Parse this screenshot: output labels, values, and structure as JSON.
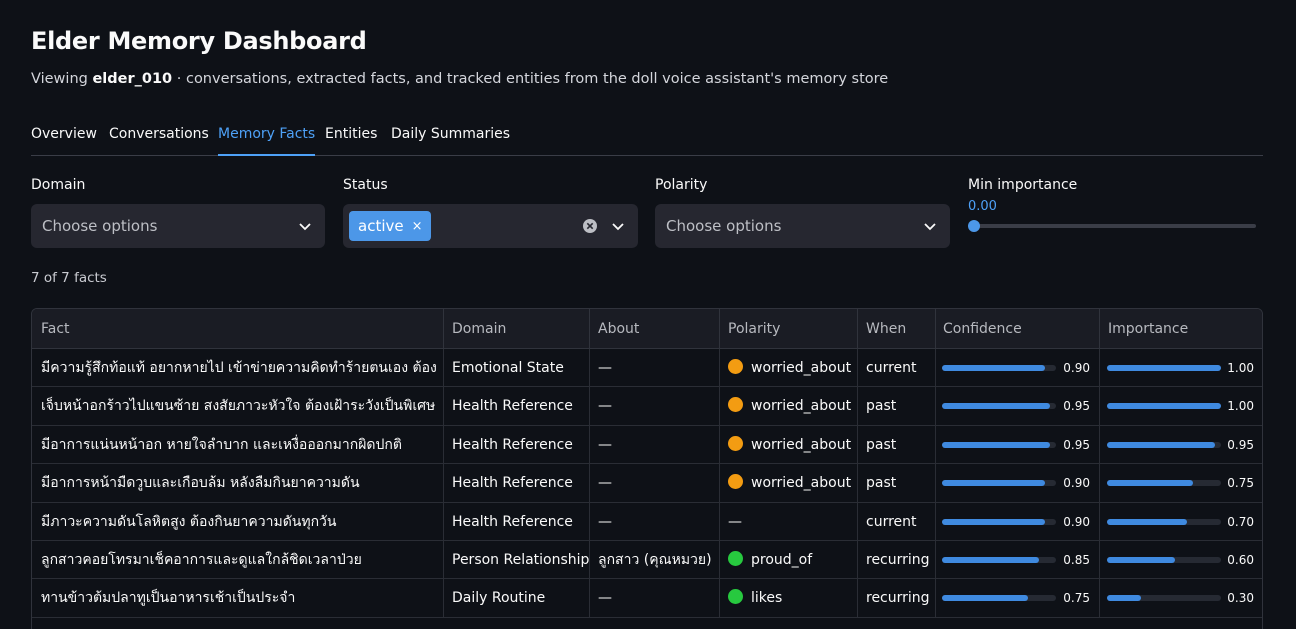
{
  "header": {
    "title": "Elder Memory Dashboard",
    "subtitle_prefix": "Viewing ",
    "subtitle_user": "elder_010",
    "subtitle_suffix": " · conversations, extracted facts, and tracked entities from the doll voice assistant's memory store"
  },
  "tabs": [
    {
      "label": "Overview",
      "active": false
    },
    {
      "label": "Conversations",
      "active": false
    },
    {
      "label": "Memory Facts",
      "active": true
    },
    {
      "label": "Entities",
      "active": false
    },
    {
      "label": "Daily Summaries",
      "active": false
    }
  ],
  "filters": {
    "domain": {
      "label": "Domain",
      "placeholder": "Choose options"
    },
    "status": {
      "label": "Status",
      "selected": "active",
      "remove_glyph": "×"
    },
    "polarity": {
      "label": "Polarity",
      "placeholder": "Choose options"
    },
    "min_importance": {
      "label": "Min importance",
      "value": "0.00",
      "fraction": 0.0
    }
  },
  "count_text": "7 of 7 facts",
  "table": {
    "columns": [
      "Fact",
      "Domain",
      "About",
      "Polarity",
      "When",
      "Confidence",
      "Importance"
    ],
    "rows": [
      {
        "fact": "มีความรู้สึกท้อแท้ อยากหายไป เข้าข่ายความคิดทำร้ายตนเอง ต้อง",
        "domain": "Emotional State",
        "about": "—",
        "polarity": "worried_about",
        "polarity_color": "#f39c12",
        "when": "current",
        "confidence": 0.9,
        "confidence_text": "0.90",
        "importance": 1.0,
        "importance_text": "1.00"
      },
      {
        "fact": "เจ็บหน้าอกร้าวไปแขนซ้าย สงสัยภาวะหัวใจ ต้องเฝ้าระวังเป็นพิเศษ",
        "domain": "Health Reference",
        "about": "—",
        "polarity": "worried_about",
        "polarity_color": "#f39c12",
        "when": "past",
        "confidence": 0.95,
        "confidence_text": "0.95",
        "importance": 1.0,
        "importance_text": "1.00"
      },
      {
        "fact": "มีอาการแน่นหน้าอก หายใจลำบาก และเหงื่อออกมากผิดปกติ",
        "domain": "Health Reference",
        "about": "—",
        "polarity": "worried_about",
        "polarity_color": "#f39c12",
        "when": "past",
        "confidence": 0.95,
        "confidence_text": "0.95",
        "importance": 0.95,
        "importance_text": "0.95"
      },
      {
        "fact": "มีอาการหน้ามืดวูบและเกือบล้ม หลังลืมกินยาความดัน",
        "domain": "Health Reference",
        "about": "—",
        "polarity": "worried_about",
        "polarity_color": "#f39c12",
        "when": "past",
        "confidence": 0.9,
        "confidence_text": "0.90",
        "importance": 0.75,
        "importance_text": "0.75"
      },
      {
        "fact": "มีภาวะความดันโลหิตสูง ต้องกินยาความดันทุกวัน",
        "domain": "Health Reference",
        "about": "—",
        "polarity": "—",
        "polarity_color": "",
        "when": "current",
        "confidence": 0.9,
        "confidence_text": "0.90",
        "importance": 0.7,
        "importance_text": "0.70"
      },
      {
        "fact": "ลูกสาวคอยโทรมาเช็คอาการและดูแลใกล้ชิดเวลาป่วย",
        "domain": "Person Relationship",
        "about": "ลูกสาว (คุณหมวย)",
        "polarity": "proud_of",
        "polarity_color": "#27c93f",
        "when": "recurring",
        "confidence": 0.85,
        "confidence_text": "0.85",
        "importance": 0.6,
        "importance_text": "0.60"
      },
      {
        "fact": "ทานข้าวต้มปลาทูเป็นอาหารเช้าเป็นประจำ",
        "domain": "Daily Routine",
        "about": "—",
        "polarity": "likes",
        "polarity_color": "#27c93f",
        "when": "recurring",
        "confidence": 0.75,
        "confidence_text": "0.75",
        "importance": 0.3,
        "importance_text": "0.30"
      }
    ]
  }
}
